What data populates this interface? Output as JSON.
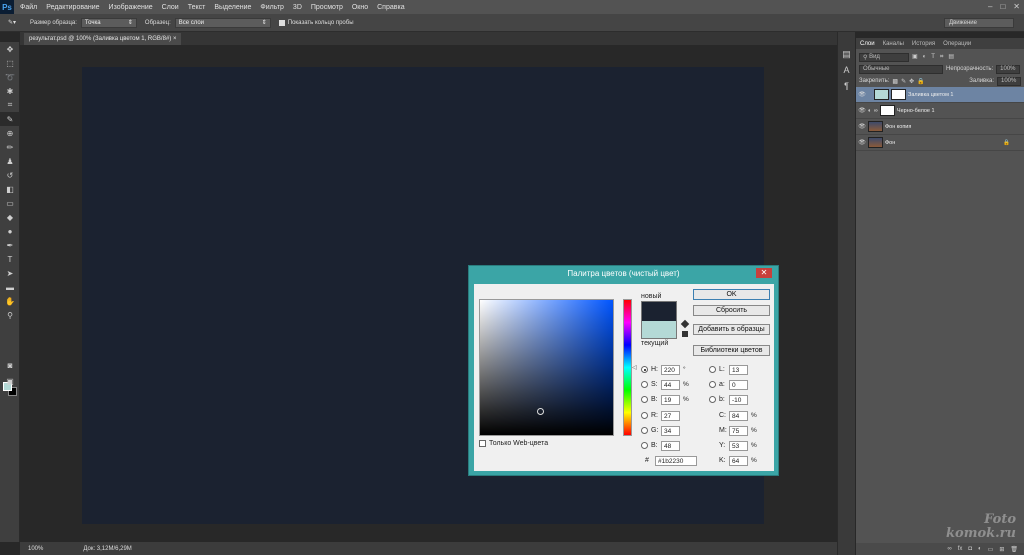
{
  "app": {
    "logo": "Ps"
  },
  "menu": [
    "Файл",
    "Редактирование",
    "Изображение",
    "Слои",
    "Текст",
    "Выделение",
    "Фильтр",
    "3D",
    "Просмотр",
    "Окно",
    "Справка"
  ],
  "window_controls": [
    "–",
    "□",
    "✕"
  ],
  "options_bar": {
    "sample_size_label": "Размер образца:",
    "sample_size_value": "Точка",
    "sample_label": "Образец:",
    "sample_value": "Все слои",
    "show_ring_label": "Показать кольцо пробы",
    "workspace": "Движение"
  },
  "document": {
    "tab_title": "результат.psd @ 100% (Заливка цветом 1, RGB/8#)",
    "canvas_color": "#1b2230"
  },
  "status": {
    "zoom": "100%",
    "doc_size": "Док: 3,12M/6,29M"
  },
  "layers_panel": {
    "tabs": [
      "Слои",
      "Каналы",
      "История",
      "Операции"
    ],
    "kind_label": "Вид",
    "blend_mode": "Обычные",
    "opacity_label": "Непрозрачность:",
    "opacity_value": "100%",
    "lock_label": "Закрепить:",
    "fill_label": "Заливка:",
    "fill_value": "100%",
    "layers": [
      {
        "name": "Заливка цветом 1"
      },
      {
        "name": "Черно-белое 1"
      },
      {
        "name": "Фон копия"
      },
      {
        "name": "Фон"
      }
    ]
  },
  "color_picker": {
    "title": "Палитра цветов (чистый цвет)",
    "new_label": "новый",
    "current_label": "текущий",
    "new_color": "#1b2230",
    "current_color": "#b4d9d6",
    "buttons": {
      "ok": "OK",
      "reset": "Сбросить",
      "add_swatch": "Добавить в образцы",
      "libraries": "Библиотеки цветов"
    },
    "hsb": {
      "h_label": "H:",
      "h": "220",
      "h_unit": "°",
      "s_label": "S:",
      "s": "44",
      "s_unit": "%",
      "b_label": "B:",
      "b": "19",
      "b_unit": "%"
    },
    "rgb": {
      "r_label": "R:",
      "r": "27",
      "g_label": "G:",
      "g": "34",
      "b_label": "B:",
      "b": "48"
    },
    "lab": {
      "l_label": "L:",
      "l": "13",
      "a_label": "a:",
      "a": "0",
      "b_label": "b:",
      "b": "-10"
    },
    "cmyk": {
      "c_label": "C:",
      "c": "84",
      "m_label": "M:",
      "m": "75",
      "y_label": "Y:",
      "y": "53",
      "k_label": "K:",
      "k": "64",
      "unit": "%"
    },
    "hex_label": "#",
    "hex": "1b2230",
    "web_only": "Только Web-цвета"
  },
  "watermark": {
    "line1": "Foto",
    "line2": "komok.ru"
  }
}
